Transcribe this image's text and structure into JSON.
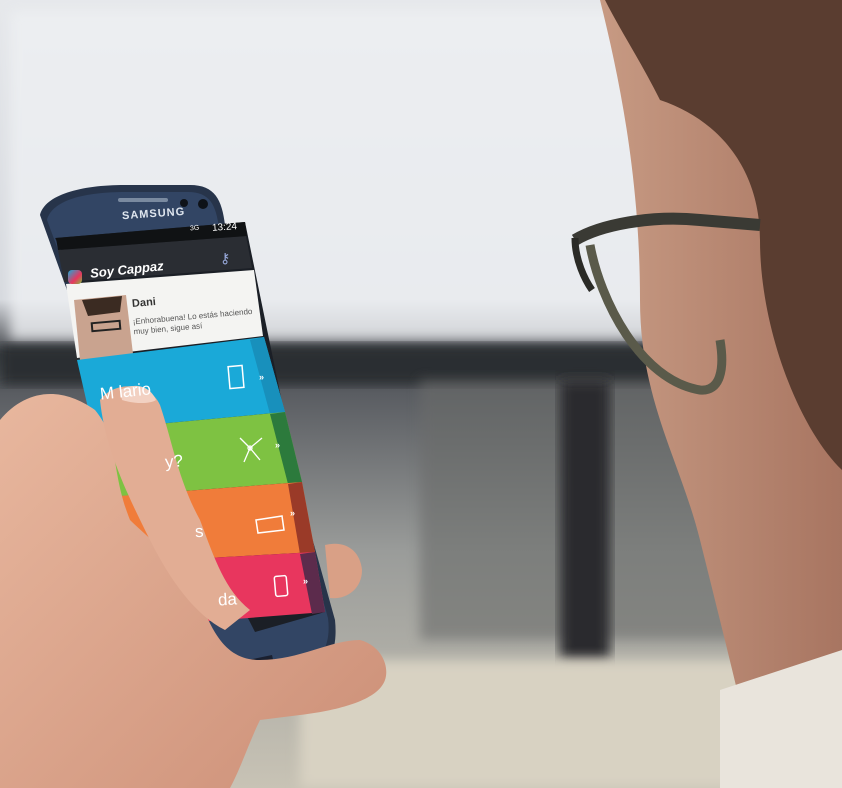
{
  "phone": {
    "brand": "SAMSUNG",
    "status_bar": {
      "network": "3G",
      "time": "13:24"
    },
    "app": {
      "title": "Soy Cappaz",
      "header_icon": "key-icon",
      "user": {
        "name": "Dani",
        "message": "¡Enhorabuena! Lo estás haciendo muy bien, sigue así"
      },
      "menu": [
        {
          "label_visible": "M   lario",
          "color": "#1aa9d8",
          "icon": "calendar-icon"
        },
        {
          "label_visible": "y?",
          "color": "#7ec242",
          "icon": "network-icon"
        },
        {
          "label_visible": "s",
          "color": "#f07c3a",
          "icon": "bed-icon"
        },
        {
          "label_visible": "da",
          "color": "#e8365e",
          "icon": "phone-icon"
        }
      ]
    }
  }
}
